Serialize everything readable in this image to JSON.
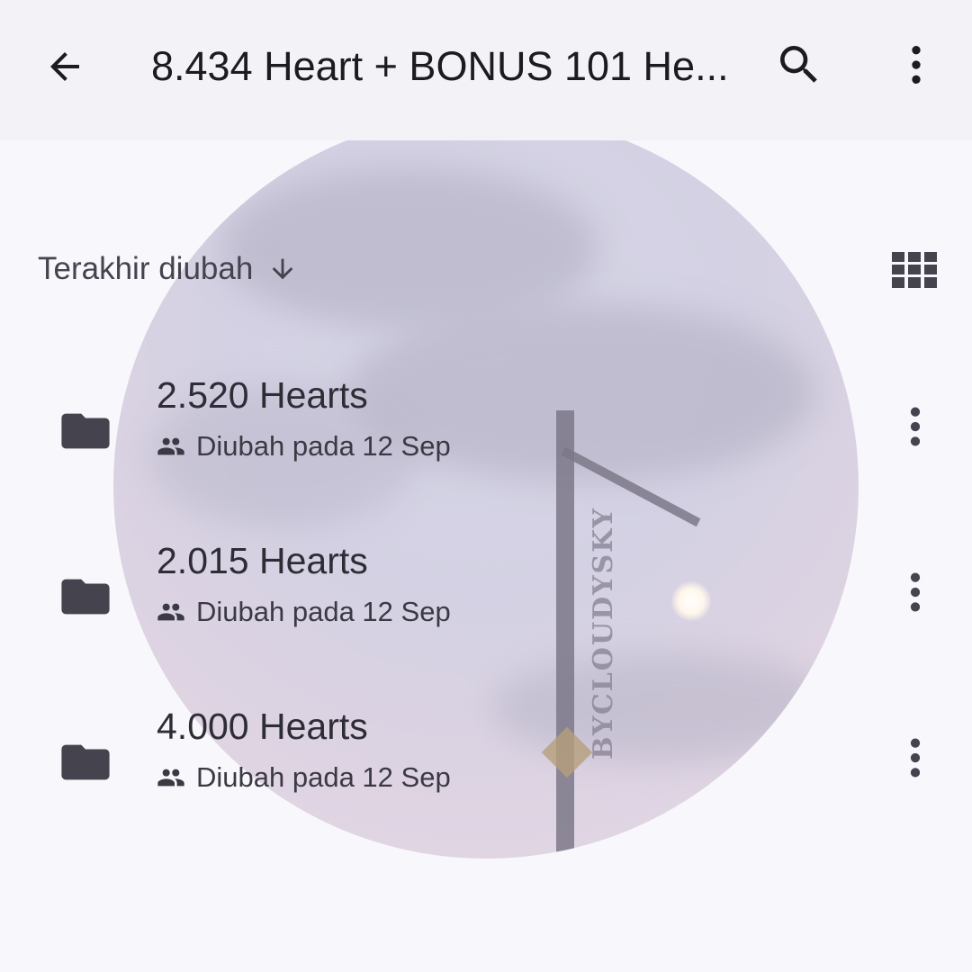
{
  "app_bar": {
    "title": "8.434 Heart + BONUS 101 He...",
    "back_icon": "arrow-back-icon",
    "search_icon": "search-icon",
    "overflow_icon": "more-vert-icon"
  },
  "sort": {
    "label": "Terakhir diubah",
    "direction_icon": "arrow-down-icon",
    "view_toggle_icon": "grid-view-icon"
  },
  "watermark": "BYCLOUDYSKY",
  "files": [
    {
      "name": "2.520 Hearts",
      "meta": "Diubah pada 12 Sep",
      "type_icon": "folder-icon",
      "shared_icon": "people-icon"
    },
    {
      "name": "2.015 Hearts",
      "meta": "Diubah pada 12 Sep",
      "type_icon": "folder-icon",
      "shared_icon": "people-icon"
    },
    {
      "name": "4.000 Hearts",
      "meta": "Diubah pada 12 Sep",
      "type_icon": "folder-icon",
      "shared_icon": "people-icon"
    }
  ],
  "colors": {
    "app_bar_bg": "#f3f2f6",
    "page_bg": "#f8f7fb",
    "icon": "#45434e",
    "text_primary": "#1c1b20"
  }
}
